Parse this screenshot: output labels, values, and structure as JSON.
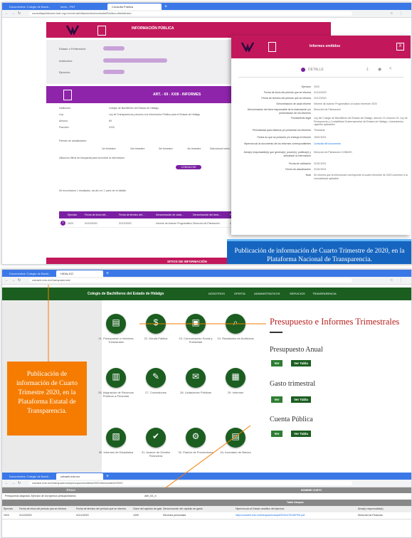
{
  "shot1": {
    "tabs": [
      "Documentos: Colegio de Bachi...",
      "Inicio - PNT",
      "Consulta Pública",
      "+"
    ],
    "url": "consultapublicamx.inai.org.mx/vut-web/faces/view/consultaPublica.xhtml#inicio",
    "header_title": "INFORMACIÓN PÚBLICA",
    "form": {
      "entity_label": "Estado o Federación:",
      "entity_value": "Hidalgo",
      "institution_label": "Institución:",
      "institution_value": "Colegio de Bachilleres del Estado de Hidalgo",
      "year_label": "Ejercicio:",
      "year_value": "2020"
    },
    "article": "ART. - 69 - XXIII - INFORMES",
    "info_rows": [
      {
        "label": "Institución:",
        "value": "Colegio de Bachilleres del Estado de Hidalgo"
      },
      {
        "label": "Ley:",
        "value": "Ley de Transparencia y Acceso a la Información Pública para el Estado de Hidalgo"
      },
      {
        "label": "Artículo:",
        "value": "69"
      },
      {
        "label": "Fracción:",
        "value": "XXIII"
      }
    ],
    "period_label": "Periodo de actualización:",
    "period_options": [
      "1er trimestre",
      "2do trimestre",
      "3er trimestre",
      "4to trimestre",
      "Seleccionar todos"
    ],
    "filters_text": "Utiliza los filtros de búsqueda para encontrar la información",
    "consultar": "CONSULTAR",
    "results_text": "Se encontraron 1 resultados, da clic en ⓘ para ver el detalle.",
    "table_headers": [
      "Ejercicio",
      "Fecha de inicio del...",
      "Fecha de término del...",
      "Denominación de cada...",
      "Denominación del área...",
      "Fundamento legal",
      "Periodicidad para..."
    ],
    "table_row": [
      "2020",
      "01/10/2020",
      "31/12/2020",
      "Informe de Avance Programático",
      "Dirección de Planeación",
      "Ley del Colegio...",
      "Trimestral"
    ],
    "footer_text": "SITIOS DE INFORMACIÓN",
    "modal": {
      "title": "Informes emitidos",
      "close": "X",
      "detail_label": "DETALLE",
      "rows": [
        {
          "label": "Ejercicio",
          "value": "2020"
        },
        {
          "label": "Fecha de inicio del periodo que se informa",
          "value": "01/10/2020"
        },
        {
          "label": "Fecha de término del periodo que se informa",
          "value": "31/12/2020"
        },
        {
          "label": "Denominación de cada informe",
          "value": "Informe de Avance Programático al cuarto trimestre 2020"
        },
        {
          "label": "Denominación del área responsable de la elaboración y/o presentación de los informes",
          "value": "Dirección de Planeación"
        },
        {
          "label": "Fundamento legal",
          "value": "Ley del Colegio de Bachilleres del Estado de Hidalgo, artículo 13, fracción XI; Ley de Presupuesto y Contabilidad Gubernamental del Estado de Hidalgo; Lineamientos vigentes aplicables"
        },
        {
          "label": "Periodicidad para elaborar y/o presentar los informes",
          "value": "Trimestral"
        },
        {
          "label": "Fecha en que se presentó y/o entregó el informe",
          "value": "15/01/2021"
        },
        {
          "label": "Hipervínculo al documento de los informes correspondientes",
          "value": "Consulta del documento",
          "link": true
        },
        {
          "label": "Área(s) responsable(s) que genera(n), posee(n), publica(n) y actualizan la información",
          "value": "Dirección de Planeación COBAEH"
        },
        {
          "label": "Fecha de validación",
          "value": "31/01/2021"
        },
        {
          "label": "Fecha de actualización",
          "value": "31/01/2021"
        },
        {
          "label": "Nota",
          "value": "Se informa que la información corresponde al cuarto trimestre de 2020 conforme a la normatividad aplicable."
        }
      ]
    },
    "caption": "Publicación de información de Cuarto Trimestre de 2020, en la Plataforma Nacional de Transparencia."
  },
  "shot2": {
    "tabs": [
      "Documentos: Colegio de Bachi...",
      "HIDALGO",
      "+"
    ],
    "url": "cobaeh.edu.mx/transparencia/",
    "brand": "Colegio de Bachilleres del Estado de Hidalgo",
    "menu": [
      "NOSOTROS",
      "OFERTA",
      "ADMINISTRATIVOS",
      "SERVICIOS",
      "TRANSPARENCIA"
    ],
    "circles": [
      {
        "icon": "document-stack-icon",
        "glyph": "▤",
        "label": "21. Presupuesto e Informes Trimestrales"
      },
      {
        "icon": "money-icon",
        "glyph": "$",
        "label": "22. Deuda Pública"
      },
      {
        "icon": "presentation-icon",
        "glyph": "▣",
        "label": "23. Comunicación Social y Publicidad"
      },
      {
        "icon": "magnifier-document-icon",
        "glyph": "⌕",
        "label": "24. Resultados de Auditorías"
      },
      {
        "icon": "clipboard-icon",
        "glyph": "▥",
        "label": "26. Asignación de Recursos Públicos a Personas"
      },
      {
        "icon": "contract-icon",
        "glyph": "✎",
        "label": "27. Concesiones"
      },
      {
        "icon": "envelope-icon",
        "glyph": "✉",
        "label": "28. Licitaciones Públicas"
      },
      {
        "icon": "report-icon",
        "glyph": "▦",
        "label": "29. Informes"
      },
      {
        "icon": "chart-report-icon",
        "glyph": "▧",
        "label": "30. Informes de Estadística"
      },
      {
        "icon": "clipboard-check-icon",
        "glyph": "✔",
        "label": "31. Avance de Gestión Financiera"
      },
      {
        "icon": "gear-people-icon",
        "glyph": "⚙",
        "label": "32. Padrón de Proveedores"
      },
      {
        "icon": "inventory-icon",
        "glyph": "▤",
        "label": "34. Inventario de Bienes"
      }
    ],
    "section_title": "Presupuesto e Informes Trimestrales",
    "subsections": [
      {
        "title": "Presupuesto Anual",
        "ver": "Ver",
        "tabla": "Ver Tabla"
      },
      {
        "title": "Gasto trimestral",
        "ver": "Ver",
        "tabla": "Ver Tabla"
      },
      {
        "title": "Cuenta Pública",
        "ver": "Ver",
        "tabla": "Ver Tabla"
      }
    ],
    "caption": "Publicación de información de Cuarto Trimestre 2020, en la Plataforma Estatal de Transparencia.",
    "tabs2": [
      "Documentos: Colegio de Bachi...",
      "cobaeh.edu.mx",
      "+"
    ],
    "url2": "cobaeh.edu.mx/transparencia/presupuesto/tabla/2020/trimestral/4t/2020",
    "table_head_left": "TÍTULO",
    "table_head_right": "NOMBRE CORTO",
    "table_title": "Presupuesto asignado, Ejercicio de los egresos presupuestarios",
    "table_short": "a69_f21_b",
    "table_group": "Tabla Campos",
    "table_cols": [
      "Ejercicio",
      "Fecha de inicio del periodo que se informa",
      "Fecha de término del periodo que se informa",
      "Clave del capítulo de gasto",
      "Denominación del capítulo de gasto",
      "Hipervínculo al Estado analítico del ejercicio",
      "Área(s) responsable(s)"
    ],
    "table_row": [
      "2020",
      "01/10/2020",
      "31/12/2020",
      "1000",
      "Servicios personales",
      "https://cobaeh.edu.mx/transparencia/pdf/2020/4T/EAEPED.pdf",
      "Dirección de Finanzas"
    ]
  },
  "colors": {
    "pnt_magenta": "#c2185b",
    "pnt_purple": "#8e24aa",
    "cobaeh_green": "#1b5e20",
    "title_red": "#b71c1c",
    "caption_blue": "#1565c0",
    "caption_orange": "#f57c00",
    "connector": "#f57c00"
  }
}
